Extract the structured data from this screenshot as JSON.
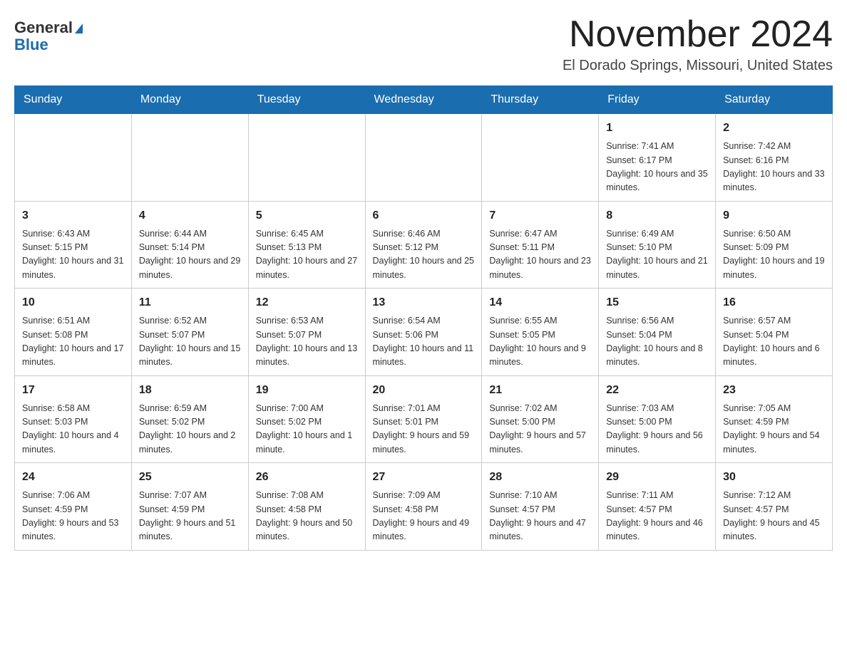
{
  "logo": {
    "brand": "General",
    "accent": "Blue"
  },
  "header": {
    "month_year": "November 2024",
    "location": "El Dorado Springs, Missouri, United States"
  },
  "weekdays": [
    "Sunday",
    "Monday",
    "Tuesday",
    "Wednesday",
    "Thursday",
    "Friday",
    "Saturday"
  ],
  "weeks": [
    [
      {
        "day": "",
        "info": ""
      },
      {
        "day": "",
        "info": ""
      },
      {
        "day": "",
        "info": ""
      },
      {
        "day": "",
        "info": ""
      },
      {
        "day": "",
        "info": ""
      },
      {
        "day": "1",
        "info": "Sunrise: 7:41 AM\nSunset: 6:17 PM\nDaylight: 10 hours and 35 minutes."
      },
      {
        "day": "2",
        "info": "Sunrise: 7:42 AM\nSunset: 6:16 PM\nDaylight: 10 hours and 33 minutes."
      }
    ],
    [
      {
        "day": "3",
        "info": "Sunrise: 6:43 AM\nSunset: 5:15 PM\nDaylight: 10 hours and 31 minutes."
      },
      {
        "day": "4",
        "info": "Sunrise: 6:44 AM\nSunset: 5:14 PM\nDaylight: 10 hours and 29 minutes."
      },
      {
        "day": "5",
        "info": "Sunrise: 6:45 AM\nSunset: 5:13 PM\nDaylight: 10 hours and 27 minutes."
      },
      {
        "day": "6",
        "info": "Sunrise: 6:46 AM\nSunset: 5:12 PM\nDaylight: 10 hours and 25 minutes."
      },
      {
        "day": "7",
        "info": "Sunrise: 6:47 AM\nSunset: 5:11 PM\nDaylight: 10 hours and 23 minutes."
      },
      {
        "day": "8",
        "info": "Sunrise: 6:49 AM\nSunset: 5:10 PM\nDaylight: 10 hours and 21 minutes."
      },
      {
        "day": "9",
        "info": "Sunrise: 6:50 AM\nSunset: 5:09 PM\nDaylight: 10 hours and 19 minutes."
      }
    ],
    [
      {
        "day": "10",
        "info": "Sunrise: 6:51 AM\nSunset: 5:08 PM\nDaylight: 10 hours and 17 minutes."
      },
      {
        "day": "11",
        "info": "Sunrise: 6:52 AM\nSunset: 5:07 PM\nDaylight: 10 hours and 15 minutes."
      },
      {
        "day": "12",
        "info": "Sunrise: 6:53 AM\nSunset: 5:07 PM\nDaylight: 10 hours and 13 minutes."
      },
      {
        "day": "13",
        "info": "Sunrise: 6:54 AM\nSunset: 5:06 PM\nDaylight: 10 hours and 11 minutes."
      },
      {
        "day": "14",
        "info": "Sunrise: 6:55 AM\nSunset: 5:05 PM\nDaylight: 10 hours and 9 minutes."
      },
      {
        "day": "15",
        "info": "Sunrise: 6:56 AM\nSunset: 5:04 PM\nDaylight: 10 hours and 8 minutes."
      },
      {
        "day": "16",
        "info": "Sunrise: 6:57 AM\nSunset: 5:04 PM\nDaylight: 10 hours and 6 minutes."
      }
    ],
    [
      {
        "day": "17",
        "info": "Sunrise: 6:58 AM\nSunset: 5:03 PM\nDaylight: 10 hours and 4 minutes."
      },
      {
        "day": "18",
        "info": "Sunrise: 6:59 AM\nSunset: 5:02 PM\nDaylight: 10 hours and 2 minutes."
      },
      {
        "day": "19",
        "info": "Sunrise: 7:00 AM\nSunset: 5:02 PM\nDaylight: 10 hours and 1 minute."
      },
      {
        "day": "20",
        "info": "Sunrise: 7:01 AM\nSunset: 5:01 PM\nDaylight: 9 hours and 59 minutes."
      },
      {
        "day": "21",
        "info": "Sunrise: 7:02 AM\nSunset: 5:00 PM\nDaylight: 9 hours and 57 minutes."
      },
      {
        "day": "22",
        "info": "Sunrise: 7:03 AM\nSunset: 5:00 PM\nDaylight: 9 hours and 56 minutes."
      },
      {
        "day": "23",
        "info": "Sunrise: 7:05 AM\nSunset: 4:59 PM\nDaylight: 9 hours and 54 minutes."
      }
    ],
    [
      {
        "day": "24",
        "info": "Sunrise: 7:06 AM\nSunset: 4:59 PM\nDaylight: 9 hours and 53 minutes."
      },
      {
        "day": "25",
        "info": "Sunrise: 7:07 AM\nSunset: 4:59 PM\nDaylight: 9 hours and 51 minutes."
      },
      {
        "day": "26",
        "info": "Sunrise: 7:08 AM\nSunset: 4:58 PM\nDaylight: 9 hours and 50 minutes."
      },
      {
        "day": "27",
        "info": "Sunrise: 7:09 AM\nSunset: 4:58 PM\nDaylight: 9 hours and 49 minutes."
      },
      {
        "day": "28",
        "info": "Sunrise: 7:10 AM\nSunset: 4:57 PM\nDaylight: 9 hours and 47 minutes."
      },
      {
        "day": "29",
        "info": "Sunrise: 7:11 AM\nSunset: 4:57 PM\nDaylight: 9 hours and 46 minutes."
      },
      {
        "day": "30",
        "info": "Sunrise: 7:12 AM\nSunset: 4:57 PM\nDaylight: 9 hours and 45 minutes."
      }
    ]
  ]
}
